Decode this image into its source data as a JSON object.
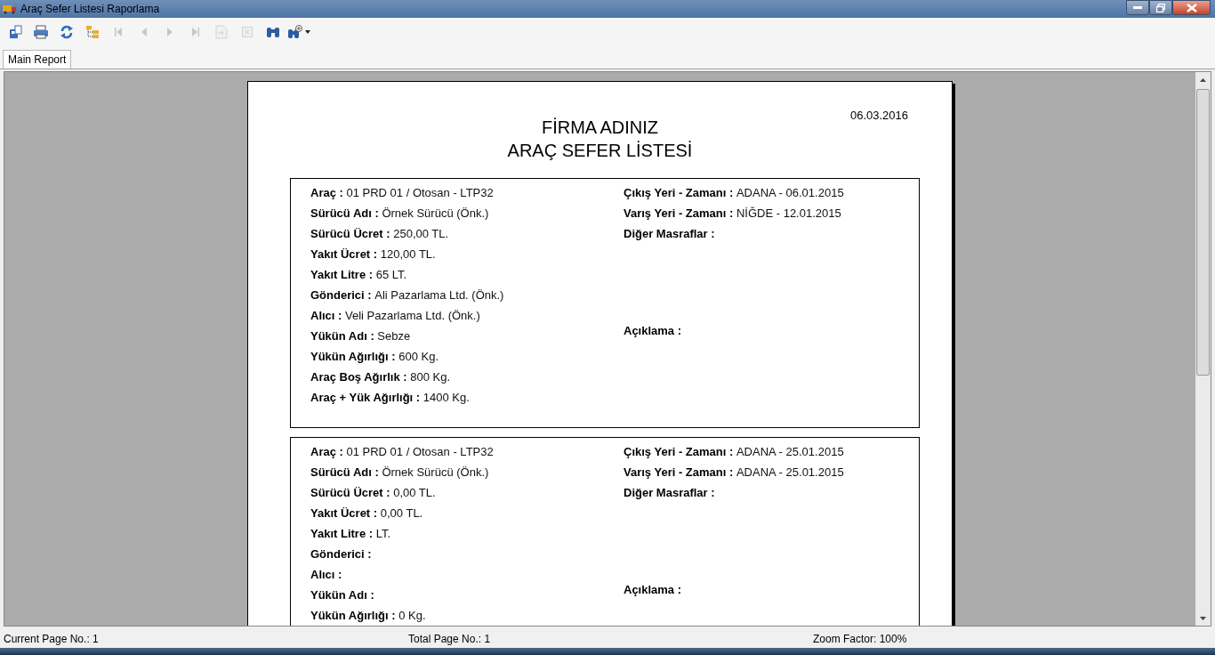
{
  "window": {
    "title": "Araç Sefer Listesi Raporlama"
  },
  "toolbar": [
    {
      "kind": "export",
      "disabled": false
    },
    {
      "kind": "print",
      "disabled": false
    },
    {
      "kind": "refresh",
      "disabled": false
    },
    {
      "kind": "tree",
      "disabled": false
    },
    {
      "kind": "first",
      "disabled": true
    },
    {
      "kind": "prev",
      "disabled": true
    },
    {
      "kind": "next",
      "disabled": true
    },
    {
      "kind": "last",
      "disabled": true
    },
    {
      "kind": "goto",
      "disabled": true
    },
    {
      "kind": "stop",
      "disabled": true
    },
    {
      "kind": "find",
      "disabled": false
    },
    {
      "kind": "zoom",
      "disabled": false
    }
  ],
  "tabs": [
    {
      "label": "Main Report",
      "selected": true
    }
  ],
  "report": {
    "date": "06.03.2016",
    "title_lines": [
      "FİRMA ADINIZ",
      "ARAÇ SEFER LİSTESİ"
    ],
    "records": [
      {
        "left": [
          {
            "label": "Araç :",
            "value": "01 PRD 01 / Otosan - LTP32"
          },
          {
            "label": "Sürücü Adı :",
            "value": "Örnek Sürücü  (Önk.)"
          },
          {
            "label": "Sürücü Ücret :",
            "value": "250,00 TL."
          },
          {
            "label": "Yakıt Ücret :",
            "value": "120,00 TL."
          },
          {
            "label": "Yakıt Litre :",
            "value": "65 LT."
          },
          {
            "label": "Gönderici :",
            "value": "Ali Pazarlama Ltd. (Önk.)"
          },
          {
            "label": "Alıcı :",
            "value": "Veli Pazarlama Ltd. (Önk.)"
          },
          {
            "label": "Yükün Adı :",
            "value": "Sebze"
          },
          {
            "label": "Yükün Ağırlığı :",
            "value": "600 Kg."
          },
          {
            "label": "Araç Boş Ağırlık :",
            "value": "800 Kg."
          },
          {
            "label": "Araç + Yük Ağırlığı :",
            "value": "1400 Kg."
          }
        ],
        "right": [
          {
            "kind": "line",
            "label": "Çıkış Yeri - Zamanı :",
            "value": "ADANA - 06.01.2015"
          },
          {
            "kind": "line",
            "label": "Varış Yeri - Zamanı :",
            "value": "NİĞDE - 12.01.2015"
          },
          {
            "kind": "line",
            "label": "Diğer Masraflar :"
          },
          {
            "kind": "note",
            "label": "Açıklama :"
          }
        ]
      },
      {
        "left": [
          {
            "label": "Araç :",
            "value": "01 PRD 01 / Otosan - LTP32"
          },
          {
            "label": "Sürücü Adı :",
            "value": "Örnek Sürücü  (Önk.)"
          },
          {
            "label": "Sürücü Ücret :",
            "value": "0,00 TL."
          },
          {
            "label": "Yakıt Ücret :",
            "value": "0,00 TL."
          },
          {
            "label": "Yakıt Litre :",
            "value": "LT."
          },
          {
            "label": "Gönderici :"
          },
          {
            "label": "Alıcı :"
          },
          {
            "label": "Yükün Adı :"
          },
          {
            "label": "Yükün Ağırlığı :",
            "value": "0 Kg."
          }
        ],
        "right": [
          {
            "kind": "line",
            "label": "Çıkış Yeri - Zamanı :",
            "value": "ADANA - 25.01.2015"
          },
          {
            "kind": "line",
            "label": "Varış Yeri - Zamanı :",
            "value": "ADANA - 25.01.2015"
          },
          {
            "kind": "line",
            "label": "Diğer Masraflar :"
          },
          {
            "kind": "note",
            "label": "Açıklama :"
          }
        ]
      }
    ]
  },
  "status_bar": {
    "current_page": "Current Page No.: 1",
    "total_pages": "Total Page No.: 1",
    "zoom": "Zoom Factor: 100%"
  }
}
